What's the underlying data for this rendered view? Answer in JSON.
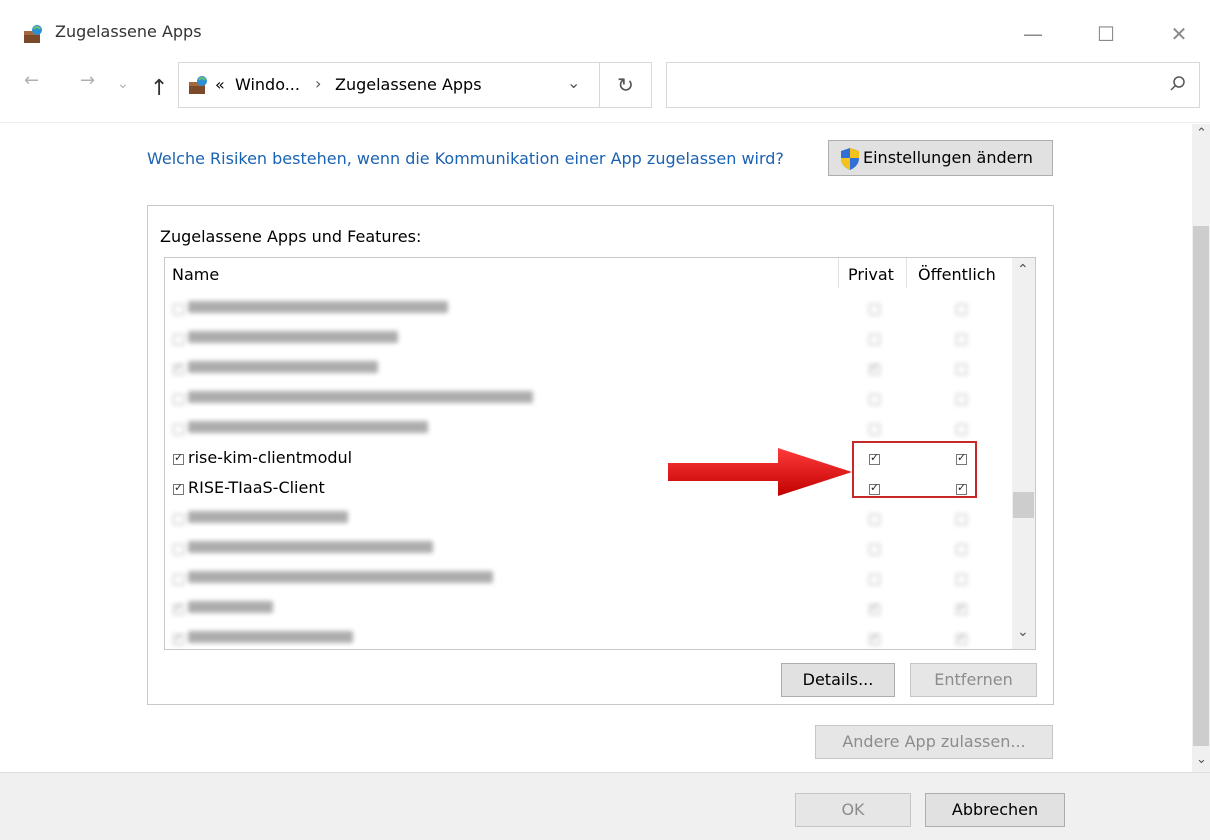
{
  "window": {
    "title": "Zugelassene Apps",
    "controls": [
      "—",
      "☐",
      "✕"
    ]
  },
  "address": {
    "prefix": "«",
    "crumb1": "Windo...",
    "separator": "›",
    "crumb2": "Zugelassene Apps",
    "dropdown": "⌄",
    "refresh": "↻",
    "search_value": ""
  },
  "nav": {
    "back": "←",
    "forward": "→",
    "recent": "⌄",
    "up": "↑"
  },
  "content": {
    "risk_link": "Welche Risiken bestehen, wenn die Kommunikation einer App zugelassen wird?",
    "settings_button": "Einstellungen ändern",
    "panel_title": "Zugelassene Apps und Features:",
    "columns": {
      "name": "Name",
      "private": "Privat",
      "public": "Öffentlich"
    },
    "rows": [
      {
        "name": "",
        "private": false,
        "public": false,
        "blurred": true,
        "w": 260
      },
      {
        "name": "",
        "private": false,
        "public": false,
        "blurred": true,
        "w": 210
      },
      {
        "name": "",
        "private": true,
        "public": false,
        "blurred": true,
        "w": 190
      },
      {
        "name": "",
        "private": false,
        "public": false,
        "blurred": true,
        "w": 345
      },
      {
        "name": "",
        "private": false,
        "public": false,
        "blurred": true,
        "w": 240
      },
      {
        "name": "rise-kim-clientmodul",
        "private": true,
        "public": true,
        "blurred": false
      },
      {
        "name": "RISE-TIaaS-Client",
        "private": true,
        "public": true,
        "blurred": false
      },
      {
        "name": "",
        "private": false,
        "public": false,
        "blurred": true,
        "w": 160
      },
      {
        "name": "",
        "private": false,
        "public": false,
        "blurred": true,
        "w": 245
      },
      {
        "name": "",
        "private": false,
        "public": false,
        "blurred": true,
        "w": 305
      },
      {
        "name": "",
        "private": true,
        "public": true,
        "blurred": true,
        "w": 85
      },
      {
        "name": "",
        "private": true,
        "public": true,
        "blurred": true,
        "w": 165
      }
    ],
    "details_button": "Details...",
    "remove_button": "Entfernen",
    "add_app_button": "Andere App zulassen..."
  },
  "footer": {
    "ok_button": "OK",
    "cancel_button": "Abbrechen"
  },
  "colors": {
    "link": "#1a62b3",
    "highlight": "#c62828",
    "arrow": "#e02020"
  },
  "icons": [
    "firewall-app-icon",
    "search-icon",
    "shield-uac-icon",
    "chevron-up-icon",
    "chevron-down-icon",
    "red-arrow-icon"
  ]
}
